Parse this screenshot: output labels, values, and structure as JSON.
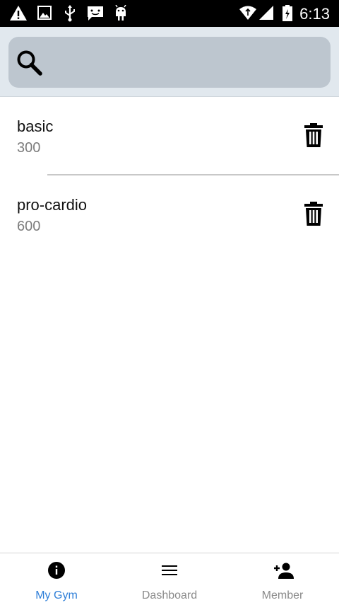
{
  "status_bar": {
    "time": "6:13"
  },
  "search": {
    "placeholder": "",
    "value": ""
  },
  "plans": [
    {
      "name": "basic",
      "price": "300"
    },
    {
      "name": "pro-cardio",
      "price": "600"
    }
  ],
  "bottom_nav": {
    "tabs": [
      {
        "label": "My Gym",
        "icon": "info-icon",
        "active": true
      },
      {
        "label": "Dashboard",
        "icon": "menu-icon",
        "active": false
      },
      {
        "label": "Member",
        "icon": "add-person-icon",
        "active": false
      }
    ],
    "active_color": "#2f7fd8",
    "inactive_color": "#8a8a8a"
  }
}
